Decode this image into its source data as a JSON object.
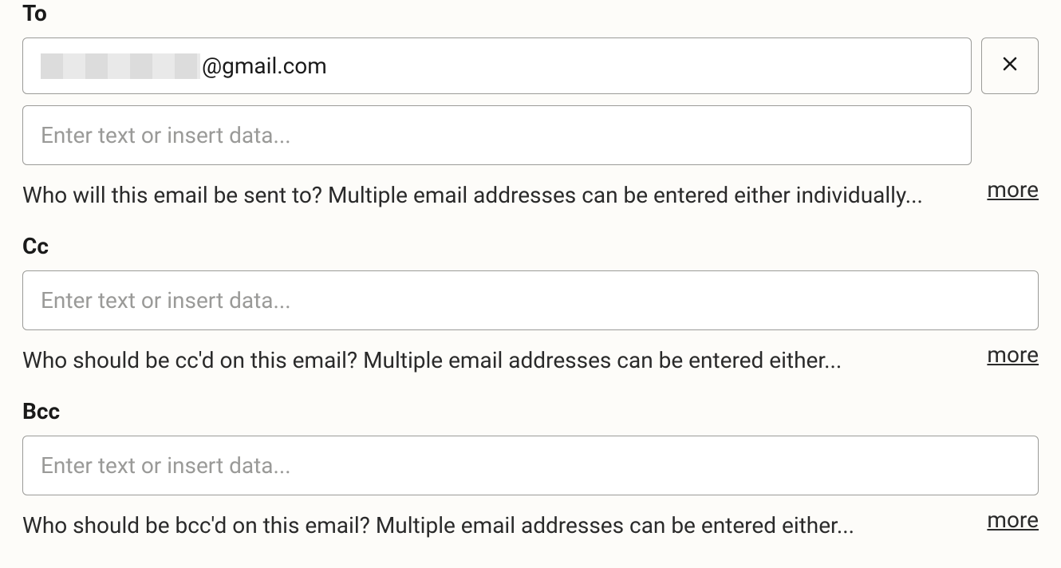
{
  "to": {
    "label": "To",
    "chip_value": "@gmail.com",
    "placeholder": "Enter text or insert data...",
    "helper": "Who will this email be sent to? Multiple email addresses can be entered either individually...",
    "more": "more"
  },
  "cc": {
    "label": "Cc",
    "placeholder": "Enter text or insert data...",
    "helper": "Who should be cc'd on this email? Multiple email addresses can be entered either...",
    "more": "more"
  },
  "bcc": {
    "label": "Bcc",
    "placeholder": "Enter text or insert data...",
    "helper": "Who should be bcc'd on this email? Multiple email addresses can be entered either...",
    "more": "more"
  }
}
